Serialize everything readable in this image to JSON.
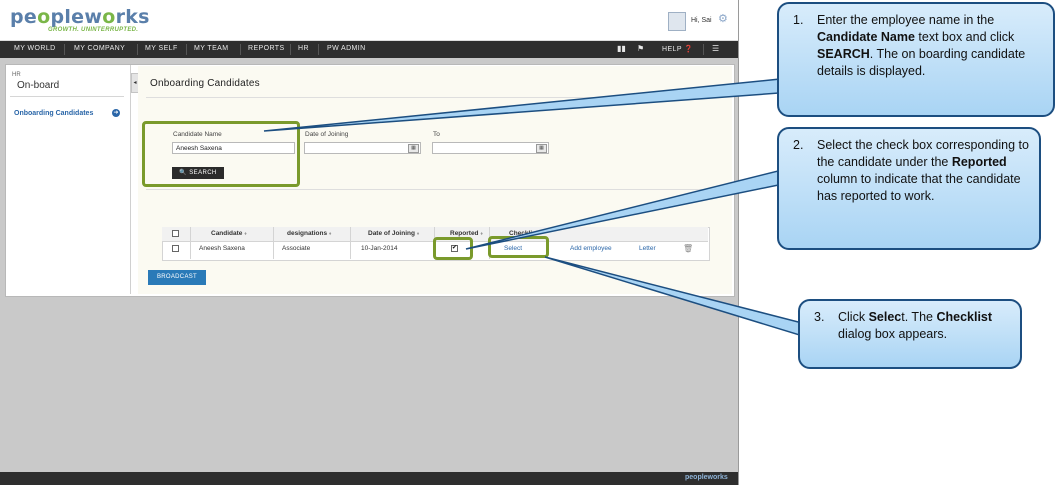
{
  "header": {
    "logo_pre": "pe",
    "logo_o": "o",
    "logo_post": "plew",
    "logo_o2": "o",
    "logo_end": "rks",
    "tagline": "GROWTH. UNINTERRUPTED.",
    "greeting": "Hi, Sai"
  },
  "nav": {
    "items": [
      "MY WORLD",
      "MY COMPANY",
      "MY SELF",
      "MY TEAM",
      "REPORTS",
      "HR",
      "PW ADMIN"
    ],
    "help": "HELP"
  },
  "sidebar": {
    "module_small": "HR",
    "module_title": "On-board",
    "item": "Onboarding Candidates"
  },
  "main": {
    "title": "Onboarding Candidates",
    "search": {
      "candidate_label": "Candidate Name",
      "candidate_value": "Aneesh  Saxena",
      "doj_label": "Date of Joining",
      "to_label": "To",
      "search_button": "SEARCH"
    },
    "table": {
      "headers": [
        "Candidate",
        "designations",
        "Date of Joining",
        "Reported",
        "Checklist"
      ],
      "sort_mark": "♦",
      "row": {
        "candidate": "Aneesh Saxena",
        "designation": "Associate",
        "doj": "10-Jan-2014",
        "reported_checked": true,
        "checklist": "Select",
        "add_employee": "Add employee",
        "letter": "Letter"
      }
    },
    "broadcast_button": "BROADCAST"
  },
  "footer": {
    "logo": "peopleworks"
  },
  "callouts": [
    {
      "number": "1.",
      "parts": [
        "Enter the employee name in the ",
        "Candidate Name",
        " text box and click ",
        "SEARCH",
        ". The on boarding candidate  details is displayed."
      ]
    },
    {
      "number": "2.",
      "parts": [
        "Select the check box corresponding to the candidate under the ",
        "Reported",
        " column  to indicate that the candidate has reported to work."
      ]
    },
    {
      "number": "3.",
      "parts": [
        "Click ",
        "Selec",
        "t. The ",
        "Checklist",
        " dialog box appears."
      ]
    }
  ],
  "colors": {
    "nav_bg": "#2e2e2e",
    "link": "#2a66a8",
    "highlight": "#7a9a2c",
    "callout_border": "#1c4e80",
    "broadcast": "#2a7ab8"
  }
}
